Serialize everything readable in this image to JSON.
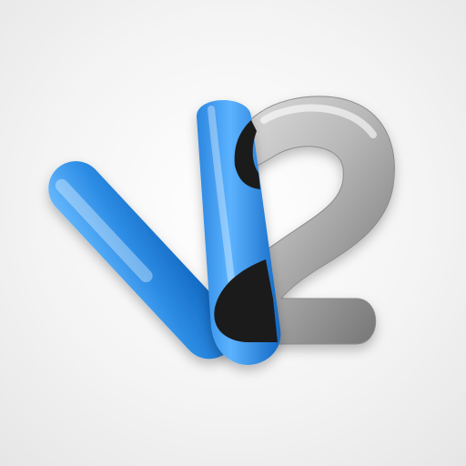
{
  "logo": {
    "icon": "v2-logo-icon",
    "colors": {
      "background": "#f2f2f2",
      "v_blue": "#2e8ee6",
      "v_blue_dark": "#0b5fb8",
      "two_silver": "#b9b9b9",
      "two_silver_dark": "#6f6f6f",
      "overlap_dark": "#1b1b1b"
    }
  }
}
